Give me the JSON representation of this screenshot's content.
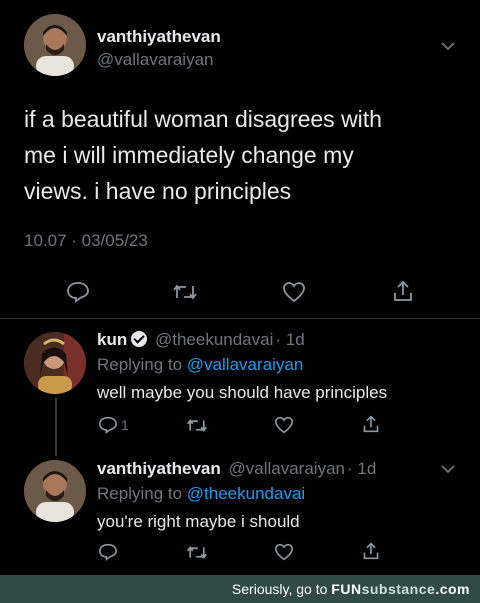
{
  "main_tweet": {
    "name": "vanthiyathevan",
    "handle": "@vallavaraiyan",
    "text_lines": [
      "if a beautiful woman disagrees with",
      "me i will immediately change my",
      "views. i have no principles"
    ],
    "timestamp": "10.07 · 03/05/23"
  },
  "reply1": {
    "name": "kun",
    "handle": "@theekundavai",
    "time": "· 1d",
    "replying_prefix": "Replying to",
    "replying_to": "@vallavaraiyan",
    "text": "well maybe you should have principles",
    "reply_count": "1"
  },
  "reply2": {
    "name": "vanthiyathevan",
    "handle": "@vallavaraiyan",
    "time": "· 1d",
    "replying_prefix": "Replying to",
    "replying_to": "@theekundavai",
    "text": "you're right maybe i should"
  },
  "footer": {
    "prefix": "Seriously, go to",
    "brand_fun": "FUN",
    "brand_sub": "substance",
    "brand_com": ".com"
  },
  "colors": {
    "background": "#000000",
    "link": "#1d9bf0",
    "muted": "#6e767d",
    "footer_bg": "#2f4a47"
  },
  "icons": [
    "chevron-down-icon",
    "comment-icon",
    "retweet-icon",
    "like-icon",
    "share-icon",
    "verified-icon"
  ]
}
